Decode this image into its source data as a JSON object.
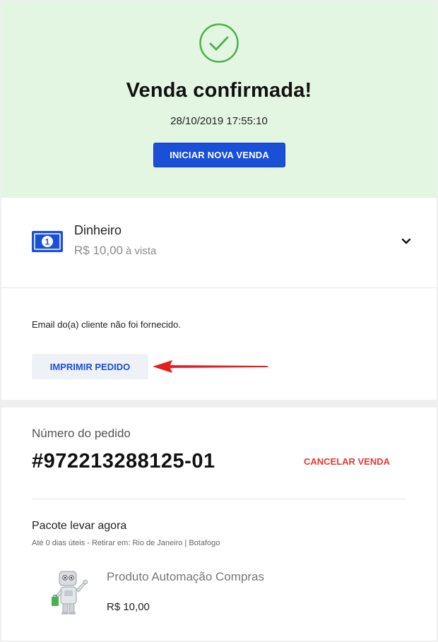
{
  "success": {
    "title": "Venda confirmada!",
    "datetime": "28/10/2019 17:55:10",
    "new_sale_button": "INICIAR NOVA VENDA",
    "accent": "#2fa84f"
  },
  "payment": {
    "method": "Dinheiro",
    "amount": "R$ 10,00",
    "terms": "à vista",
    "icon": "cash-note-icon",
    "email_notice": "Email do(a) cliente não foi fornecido.",
    "print_button": "IMPRIMIR PEDIDO"
  },
  "order": {
    "number_label": "Número do pedido",
    "number": "#972213288125-01",
    "cancel_link": "CANCELAR VENDA",
    "package_title": "Pacote levar agora",
    "package_detail": "Até 0 dias úteis - Retirar em: Rio de Janeiro | Botafogo",
    "product": {
      "name": "Produto Automação Compras",
      "price": "R$ 10,00",
      "image": "robot-shopping-image"
    }
  },
  "colors": {
    "primary": "#1a4fd8",
    "danger": "#e53935",
    "success_bg": "#e3f6e1"
  }
}
